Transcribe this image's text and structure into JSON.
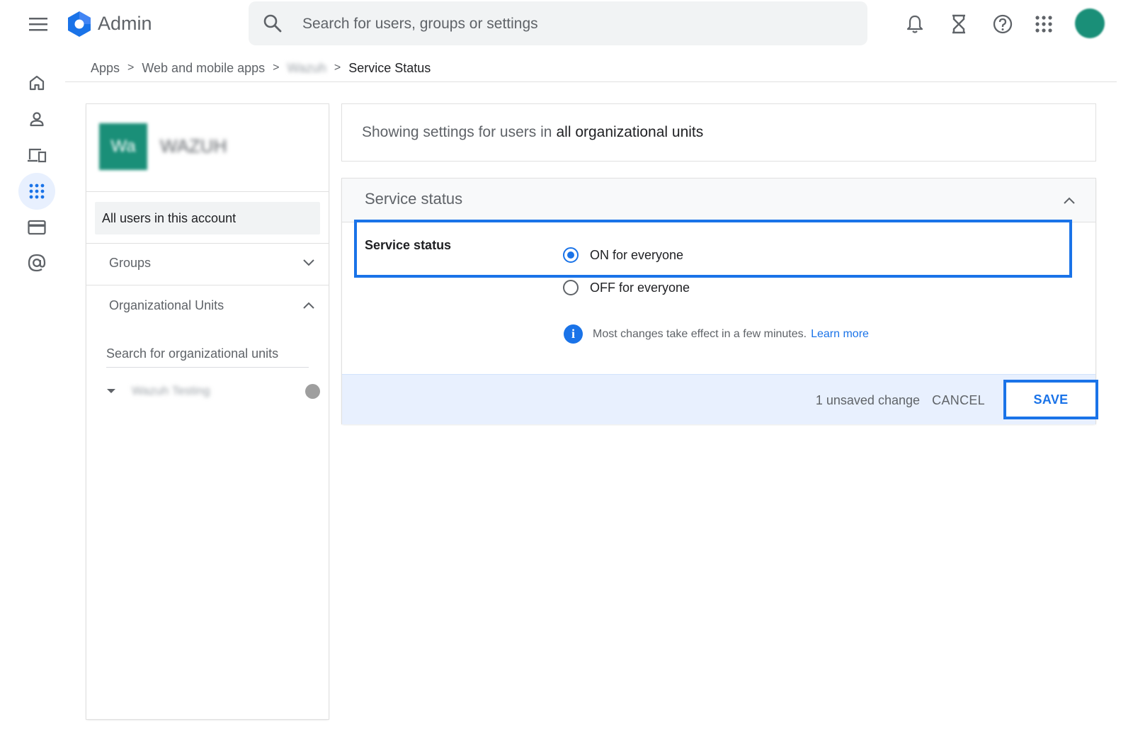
{
  "header": {
    "app_title": "Admin",
    "search_placeholder": "Search for users, groups or settings",
    "icons": [
      "menu-icon",
      "admin-logo-icon",
      "search-icon",
      "bell-icon",
      "hourglass-icon",
      "help-icon",
      "apps-grid-icon",
      "avatar"
    ]
  },
  "rail": {
    "items": [
      {
        "name": "home-icon"
      },
      {
        "name": "person-icon"
      },
      {
        "name": "devices-icon"
      },
      {
        "name": "apps-icon",
        "active": true
      },
      {
        "name": "billing-icon"
      },
      {
        "name": "at-sign-icon"
      }
    ]
  },
  "breadcrumb": {
    "items": [
      "Apps",
      "Web and mobile apps",
      "Wazuh",
      "Service Status"
    ],
    "separator": ">"
  },
  "left_panel": {
    "app_tile_text": "Wa",
    "app_name": "WAZUH",
    "all_users": "All users in this account",
    "groups": "Groups",
    "org_units": "Organizational Units",
    "ou_search_placeholder": "Search for organizational units",
    "ou_item": "Wazuh Testing"
  },
  "info_card": {
    "prefix": "Showing settings for users in",
    "scope": "all organizational units"
  },
  "status_card": {
    "title": "Service status",
    "setting_label": "Service status",
    "options": [
      {
        "label": "ON for everyone",
        "selected": true
      },
      {
        "label": "OFF for everyone",
        "selected": false
      }
    ],
    "note": "Most changes take effect in a few minutes.",
    "learn_more": "Learn more",
    "unsaved": "1 unsaved change",
    "cancel": "CANCEL",
    "save": "SAVE"
  },
  "colors": {
    "accent": "#1a73e8",
    "app_tile": "#1a8f78",
    "footer_bg": "#e8f0fe"
  }
}
